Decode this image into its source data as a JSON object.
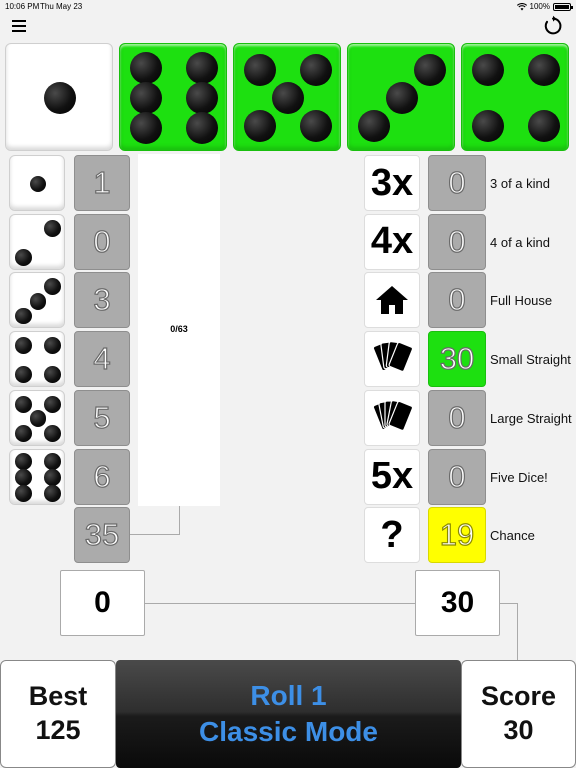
{
  "status_bar": {
    "time": "10:06 PM",
    "date": "Thu May 23",
    "battery": "100%"
  },
  "nav": {
    "menu_icon": "hamburger-icon",
    "reset_icon": "refresh-icon"
  },
  "dice": [
    {
      "value": 1,
      "held": false
    },
    {
      "value": 6,
      "held": true
    },
    {
      "value": 5,
      "held": true
    },
    {
      "value": 3,
      "held": true
    },
    {
      "value": 4,
      "held": true
    }
  ],
  "upper_section": {
    "rows": [
      {
        "die": 1,
        "score": "1"
      },
      {
        "die": 2,
        "score": "0"
      },
      {
        "die": 3,
        "score": "3"
      },
      {
        "die": 4,
        "score": "4"
      },
      {
        "die": 5,
        "score": "5"
      },
      {
        "die": 6,
        "score": "6"
      }
    ],
    "bonus": "35",
    "progress": "0/63",
    "total": "0"
  },
  "lower_section": {
    "rows": [
      {
        "icon": "3x",
        "score": "0",
        "label": "3 of a kind",
        "state": "normal"
      },
      {
        "icon": "4x",
        "score": "0",
        "label": "4 of a kind",
        "state": "normal"
      },
      {
        "icon": "house-icon",
        "score": "0",
        "label": "Full House",
        "state": "normal"
      },
      {
        "icon": "cards-4-icon",
        "score": "30",
        "label": "Small Straight",
        "state": "green"
      },
      {
        "icon": "cards-5-icon",
        "score": "0",
        "label": "Large Straight",
        "state": "normal"
      },
      {
        "icon": "5x",
        "score": "0",
        "label": "Five Dice!",
        "state": "normal"
      },
      {
        "icon": "?",
        "score": "19",
        "label": "Chance",
        "state": "yellow"
      }
    ],
    "total": "30"
  },
  "footer": {
    "best_label": "Best",
    "best_value": "125",
    "roll_label": "Roll 1",
    "mode_label": "Classic Mode",
    "score_label": "Score",
    "score_value": "30"
  },
  "colors": {
    "held": "#1de010",
    "highlight": "#ffff00",
    "cell": "#ababab",
    "roll_text": "#3d8fe6"
  }
}
